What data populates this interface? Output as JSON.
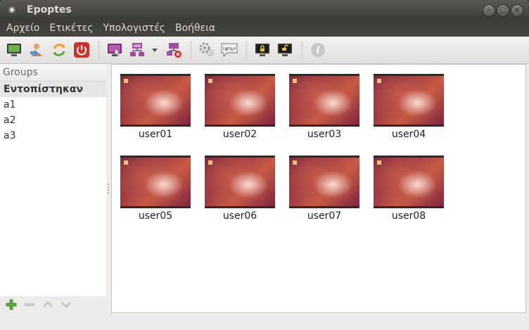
{
  "window": {
    "title": "Epoptes"
  },
  "menu": [
    "Αρχείο",
    "Ετικέτες",
    "Υπολογιστές",
    "Βοήθεια"
  ],
  "toolbar": {
    "icons": [
      "broadcast-screen-icon",
      "login-user-icon",
      "reboot-icon",
      "shutdown-icon",
      "observe-screen-icon",
      "assist-network-icon",
      "dropdown-arrow-icon",
      "stop-broadcast-icon",
      "execute-command-icon",
      "send-message-icon",
      "lock-screen-icon",
      "unlock-screen-icon",
      "info-icon"
    ]
  },
  "sidebar": {
    "header": "Groups",
    "groups": [
      "Εντοπίστηκαν",
      "a1",
      "a2",
      "a3"
    ],
    "selected_index": 0
  },
  "clients": [
    "user01",
    "user02",
    "user03",
    "user04",
    "user05",
    "user06",
    "user07",
    "user08"
  ],
  "colors": {
    "accent": "#d64c38",
    "titlebar": "#3c3b37"
  }
}
